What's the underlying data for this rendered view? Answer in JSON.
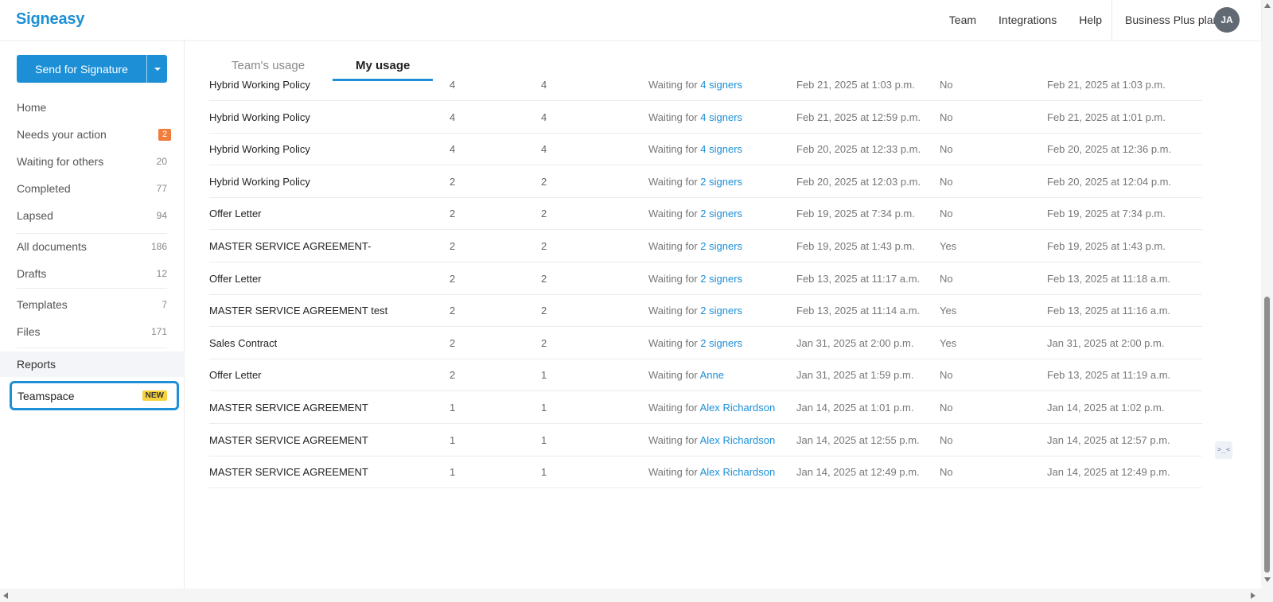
{
  "app": {
    "logo": "Signeasy"
  },
  "header": {
    "nav": [
      "Team",
      "Integrations",
      "Help"
    ],
    "plan": "Business Plus plan",
    "avatar_initials": "JA"
  },
  "sidebar": {
    "send_button": "Send for Signature",
    "items": [
      {
        "label": "Home",
        "count": ""
      },
      {
        "label": "Needs your action",
        "count": "2"
      },
      {
        "label": "Waiting for others",
        "count": "20"
      },
      {
        "label": "Completed",
        "count": "77"
      },
      {
        "label": "Lapsed",
        "count": "94"
      },
      {
        "label": "All documents",
        "count": "186"
      },
      {
        "label": "Drafts",
        "count": "12"
      },
      {
        "label": "Templates",
        "count": "7"
      },
      {
        "label": "Files",
        "count": "171"
      },
      {
        "label": "Reports",
        "count": ""
      }
    ],
    "teamspace": {
      "label": "Teamspace",
      "badge": "NEW"
    }
  },
  "tabs": {
    "team": "Team's usage",
    "my": "My usage"
  },
  "table": {
    "rows": [
      {
        "doc": "Hybrid Working Policy",
        "n1": "4",
        "n2": "4",
        "status_prefix": "Waiting for",
        "status_link": "4 signers",
        "sent": "Feb 21, 2025 at 1:03 p.m.",
        "yn": "No",
        "last": "Feb 21, 2025 at 1:03 p.m."
      },
      {
        "doc": "Hybrid Working Policy",
        "n1": "4",
        "n2": "4",
        "status_prefix": "Waiting for",
        "status_link": "4 signers",
        "sent": "Feb 21, 2025 at 12:59 p.m.",
        "yn": "No",
        "last": "Feb 21, 2025 at 1:01 p.m."
      },
      {
        "doc": "Hybrid Working Policy",
        "n1": "4",
        "n2": "4",
        "status_prefix": "Waiting for",
        "status_link": "4 signers",
        "sent": "Feb 20, 2025 at 12:33 p.m.",
        "yn": "No",
        "last": "Feb 20, 2025 at 12:36 p.m."
      },
      {
        "doc": "Hybrid Working Policy",
        "n1": "2",
        "n2": "2",
        "status_prefix": "Waiting for",
        "status_link": "2 signers",
        "sent": "Feb 20, 2025 at 12:03 p.m.",
        "yn": "No",
        "last": "Feb 20, 2025 at 12:04 p.m."
      },
      {
        "doc": "Offer Letter",
        "n1": "2",
        "n2": "2",
        "status_prefix": "Waiting for",
        "status_link": "2 signers",
        "sent": "Feb 19, 2025 at 7:34 p.m.",
        "yn": "No",
        "last": "Feb 19, 2025 at 7:34 p.m."
      },
      {
        "doc": "MASTER SERVICE AGREEMENT-",
        "n1": "2",
        "n2": "2",
        "status_prefix": "Waiting for",
        "status_link": "2 signers",
        "sent": "Feb 19, 2025 at 1:43 p.m.",
        "yn": "Yes",
        "last": "Feb 19, 2025 at 1:43 p.m."
      },
      {
        "doc": "Offer Letter",
        "n1": "2",
        "n2": "2",
        "status_prefix": "Waiting for",
        "status_link": "2 signers",
        "sent": "Feb 13, 2025 at 11:17 a.m.",
        "yn": "No",
        "last": "Feb 13, 2025 at 11:18 a.m."
      },
      {
        "doc": "MASTER SERVICE AGREEMENT test",
        "n1": "2",
        "n2": "2",
        "status_prefix": "Waiting for",
        "status_link": "2 signers",
        "sent": "Feb 13, 2025 at 11:14 a.m.",
        "yn": "Yes",
        "last": "Feb 13, 2025 at 11:16 a.m."
      },
      {
        "doc": "Sales Contract",
        "n1": "2",
        "n2": "2",
        "status_prefix": "Waiting for",
        "status_link": "2 signers",
        "sent": "Jan 31, 2025 at 2:00 p.m.",
        "yn": "Yes",
        "last": "Jan 31, 2025 at 2:00 p.m."
      },
      {
        "doc": "Offer Letter",
        "n1": "2",
        "n2": "1",
        "status_prefix": "Waiting for",
        "status_link": "Anne",
        "sent": "Jan 31, 2025 at 1:59 p.m.",
        "yn": "No",
        "last": "Feb 13, 2025 at 11:19 a.m."
      },
      {
        "doc": "MASTER SERVICE AGREEMENT",
        "n1": "1",
        "n2": "1",
        "status_prefix": "Waiting for",
        "status_link": "Alex Richardson",
        "sent": "Jan 14, 2025 at 1:01 p.m.",
        "yn": "No",
        "last": "Jan 14, 2025 at 1:02 p.m."
      },
      {
        "doc": "MASTER SERVICE AGREEMENT",
        "n1": "1",
        "n2": "1",
        "status_prefix": "Waiting for",
        "status_link": "Alex Richardson",
        "sent": "Jan 14, 2025 at 12:55 p.m.",
        "yn": "No",
        "last": "Jan 14, 2025 at 12:57 p.m."
      },
      {
        "doc": "MASTER SERVICE AGREEMENT",
        "n1": "1",
        "n2": "1",
        "status_prefix": "Waiting for",
        "status_link": "Alex Richardson",
        "sent": "Jan 14, 2025 at 12:49 p.m.",
        "yn": "No",
        "last": "Jan 14, 2025 at 12:49 p.m."
      }
    ]
  },
  "chat_widget": {
    "glyph": ">_<"
  },
  "colors": {
    "accent": "#1c8fd6",
    "badge_orange": "#f07d3c",
    "badge_new": "#f6d33d"
  }
}
